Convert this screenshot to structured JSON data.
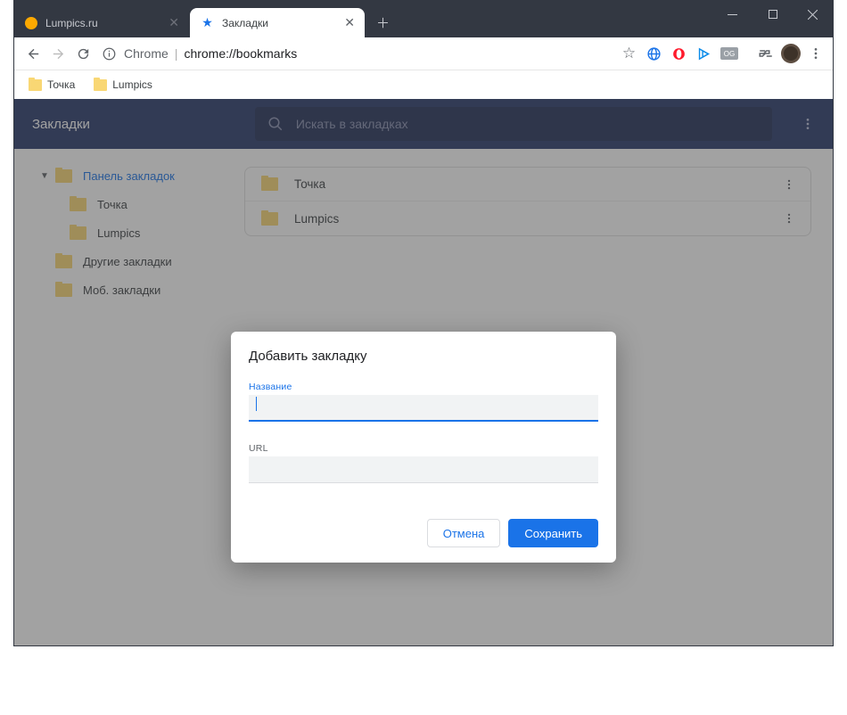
{
  "titlebar": {
    "tabs": [
      {
        "title": "Lumpics.ru",
        "icon": "orange"
      },
      {
        "title": "Закладки",
        "icon": "star"
      }
    ]
  },
  "toolbar": {
    "url_host": "Chrome",
    "url_path": "chrome://bookmarks"
  },
  "bookmarks_bar": {
    "items": [
      {
        "label": "Точка"
      },
      {
        "label": "Lumpics"
      }
    ]
  },
  "app": {
    "title": "Закладки",
    "search_placeholder": "Искать в закладках",
    "tree": [
      {
        "label": "Панель закладок",
        "level": 1,
        "expanded": true,
        "selected": true
      },
      {
        "label": "Точка",
        "level": 2
      },
      {
        "label": "Lumpics",
        "level": 2
      },
      {
        "label": "Другие закладки",
        "level": 1
      },
      {
        "label": "Моб. закладки",
        "level": 1
      }
    ],
    "list": [
      {
        "label": "Точка"
      },
      {
        "label": "Lumpics"
      }
    ]
  },
  "dialog": {
    "title": "Добавить закладку",
    "name_label": "Название",
    "name_value": "",
    "url_label": "URL",
    "url_value": "",
    "cancel": "Отмена",
    "save": "Сохранить"
  }
}
